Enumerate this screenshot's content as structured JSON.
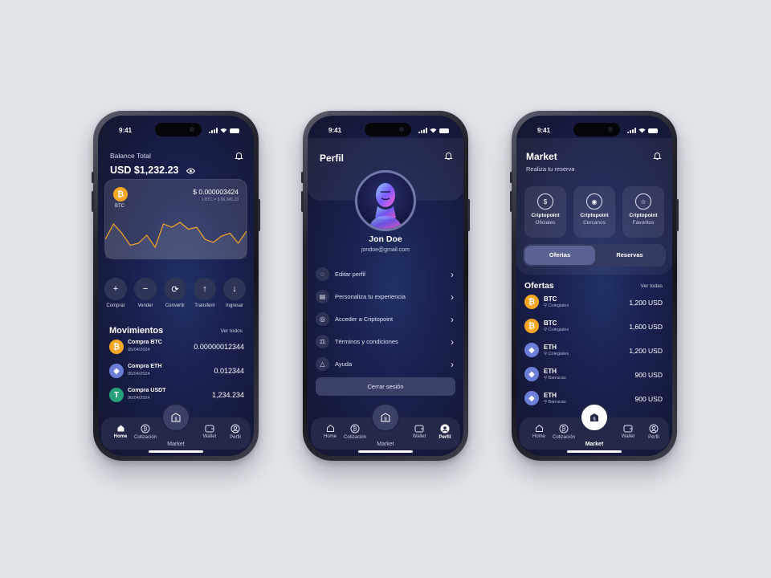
{
  "status_time": "9:41",
  "nav": {
    "items": [
      "Home",
      "Cotización",
      "Market",
      "Wallet",
      "Perfil"
    ]
  },
  "home": {
    "balance_label": "Balance Total",
    "balance_value": "USD $1,232.23",
    "btc": {
      "symbol": "BTC",
      "amount": "$ 0.000003424",
      "sub": "1 BTC = $ 66,345.23"
    },
    "chart_data": {
      "type": "line",
      "values": [
        40,
        78,
        55,
        25,
        30,
        50,
        20,
        78,
        70,
        82,
        65,
        70,
        40,
        32,
        48,
        55,
        30,
        60
      ]
    },
    "actions": [
      "Comprar",
      "Vender",
      "Convertir",
      "Transferir",
      "Ingresar"
    ],
    "movements_title": "Movimientos",
    "see_all": "Ver todos",
    "movements": [
      {
        "title": "Compra BTC",
        "date": "05/04/2024",
        "amount": "0.00000012344",
        "coin": "B"
      },
      {
        "title": "Compra ETH",
        "date": "05/04/2024",
        "amount": "0.012344",
        "coin": "E"
      },
      {
        "title": "Compra USDT",
        "date": "06/04/2024",
        "amount": "1,234.234",
        "coin": "T"
      }
    ]
  },
  "profile": {
    "title": "Perfil",
    "name": "Jon Doe",
    "email": "jondoe@gmail.com",
    "menu": [
      "Editar perfil",
      "Personaliza tu experiencia",
      "Acceder a Criptopoint",
      "Términos y condiciones",
      "Ayuda"
    ],
    "logout": "Cerrar sesión"
  },
  "market": {
    "title": "Market",
    "subtitle": "Realiza tu reserva",
    "cards": [
      {
        "title": "Criptopoint",
        "sub": "Oficiales"
      },
      {
        "title": "Criptopoint",
        "sub": "Cercanos"
      },
      {
        "title": "Criptopoint",
        "sub": "Favoritos"
      }
    ],
    "tabs": [
      "Ofertas",
      "Reservas"
    ],
    "offers_title": "Ofertas",
    "see_all": "Ver todas",
    "offers": [
      {
        "symbol": "BTC",
        "place": "Colegiales",
        "price": "1,200 USD",
        "coin": "B"
      },
      {
        "symbol": "BTC",
        "place": "Colegiales",
        "price": "1,600 USD",
        "coin": "B"
      },
      {
        "symbol": "ETH",
        "place": "Colegiales",
        "price": "1,200 USD",
        "coin": "E"
      },
      {
        "symbol": "ETH",
        "place": "Barracas",
        "price": "900 USD",
        "coin": "E"
      },
      {
        "symbol": "ETH",
        "place": "Barracas",
        "price": "900 USD",
        "coin": "E"
      }
    ]
  }
}
